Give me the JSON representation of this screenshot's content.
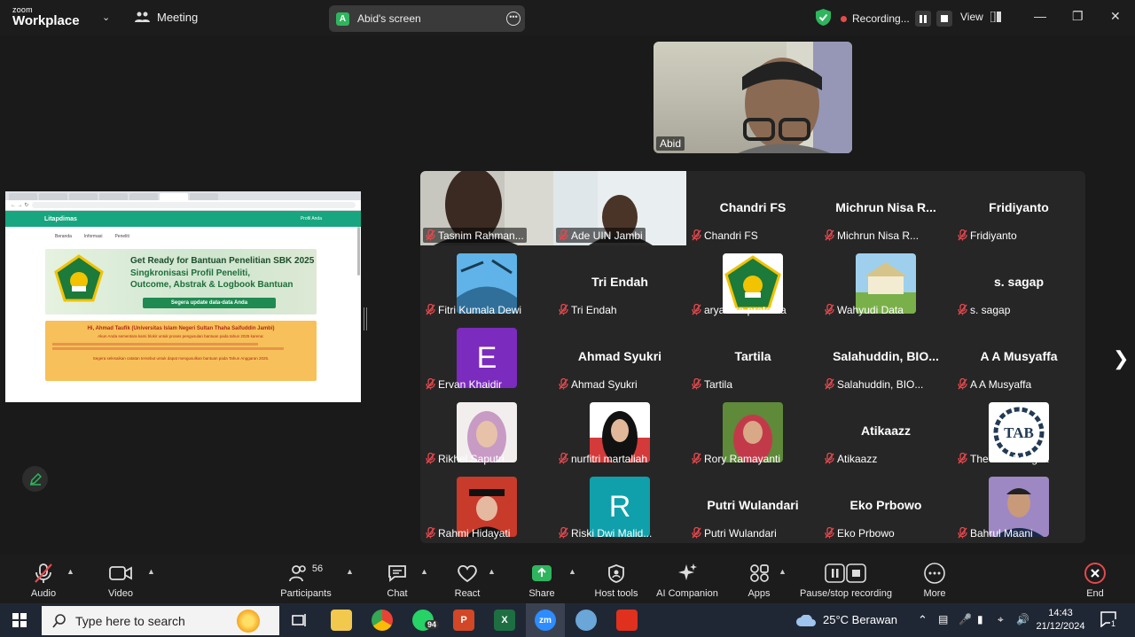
{
  "topbar": {
    "brand_line1": "zoom",
    "brand_line2": "Workplace",
    "meeting_label": "Meeting",
    "screen_badge": "A",
    "screen_label": "Abid's screen",
    "recording_label": "Recording...",
    "view_label": "View"
  },
  "shared_screen": {
    "site_name": "Litapdimas",
    "site_right": "Profil Anda",
    "menu": [
      "Beranda",
      "Informasi",
      "Peneliti"
    ],
    "banner_title": "Get Ready for Bantuan Penelitian SBK 2025",
    "banner_sub1": "Singkronisasi Profil Peneliti,",
    "banner_sub2": "Outcome, Abstrak & Logbook Bantuan",
    "banner_cta": "Segera update data-data Anda",
    "notice_title": "Hi, Ahmad Taufik (Universitas Islam Negeri Sultan Thaha Saifuddin Jambi)",
    "notice_line": "Akun Anda sementara kami blokir untuk proses pengusulan bantuan pada tahun 2025 karena:",
    "notice_footer": "Segera selesaikan catatan tersebut untuk dapat mengusulkan bantuan pada Tahun Anggaran 2025."
  },
  "self_video": {
    "name": "Abid"
  },
  "participants": [
    {
      "name": "Tasnim Rahman...",
      "big": "",
      "avatar": "video-dark"
    },
    {
      "name": "Ade UIN Jambi",
      "big": "",
      "avatar": "video-light"
    },
    {
      "name": "Chandri  FS",
      "big": "Chandri  FS",
      "avatar": ""
    },
    {
      "name": "Michrun Nisa R...",
      "big": "Michrun Nisa R...",
      "avatar": ""
    },
    {
      "name": "Fridiyanto",
      "big": "Fridiyanto",
      "avatar": ""
    },
    {
      "name": "Fitri Kumala Dewi",
      "big": "",
      "avatar": "photo-sky"
    },
    {
      "name": "Tri Endah",
      "big": "Tri Endah",
      "avatar": ""
    },
    {
      "name": "aryawira pratama",
      "big": "",
      "avatar": "emblem"
    },
    {
      "name": "Wahyudi Data",
      "big": "",
      "avatar": "photo-building"
    },
    {
      "name": "s. sagap",
      "big": "s. sagap",
      "avatar": ""
    },
    {
      "name": "Ervan Khaidir",
      "big": "",
      "avatar": "letter-e"
    },
    {
      "name": "Ahmad Syukri",
      "big": "Ahmad Syukri",
      "avatar": ""
    },
    {
      "name": "Tartila",
      "big": "Tartila",
      "avatar": ""
    },
    {
      "name": "Salahuddin,  BIO...",
      "big": "Salahuddin,  BIO...",
      "avatar": ""
    },
    {
      "name": "A A Musyaffa",
      "big": "A A Musyaffa",
      "avatar": ""
    },
    {
      "name": "Rikhel Saputri",
      "big": "",
      "avatar": "photo-hijab-pink"
    },
    {
      "name": "nurfitri martaliah",
      "big": "",
      "avatar": "photo-hijab-black"
    },
    {
      "name": "Rory Ramayanti",
      "big": "",
      "avatar": "photo-hijab-red"
    },
    {
      "name": "Atikaazz",
      "big": "Atikaazz",
      "avatar": ""
    },
    {
      "name": "Theo Ari Bangsa",
      "big": "",
      "avatar": "logo-tab"
    },
    {
      "name": "Rahmi Hidayati",
      "big": "",
      "avatar": "photo-graduate"
    },
    {
      "name": "Riski Dwi Malid...",
      "big": "",
      "avatar": "letter-r"
    },
    {
      "name": "Putri Wulandari",
      "big": "Putri Wulandari",
      "avatar": ""
    },
    {
      "name": "Eko Prbowo",
      "big": "Eko Prbowo",
      "avatar": ""
    },
    {
      "name": "Bahrul Maani",
      "big": "",
      "avatar": "photo-man"
    }
  ],
  "avatar_letters": {
    "letter-e": "E",
    "letter-r": "R",
    "logo-tab": "TAB"
  },
  "toolbar": {
    "audio": "Audio",
    "video": "Video",
    "participants": "Participants",
    "participants_count": "56",
    "chat": "Chat",
    "react": "React",
    "share": "Share",
    "host_tools": "Host tools",
    "ai_companion": "AI Companion",
    "apps": "Apps",
    "pause_recording": "Pause/stop recording",
    "more": "More",
    "end": "End"
  },
  "taskbar": {
    "search_placeholder": "Type here to search",
    "whatsapp_badge": "94",
    "zoom_icon": "zm",
    "weather": "25°C  Berawan",
    "time": "14:43",
    "date": "21/12/2024",
    "notif_count": "1"
  },
  "colors": {
    "accent_green": "#17a680",
    "muted_red": "#e5484d",
    "share_green": "#2fb55d"
  }
}
